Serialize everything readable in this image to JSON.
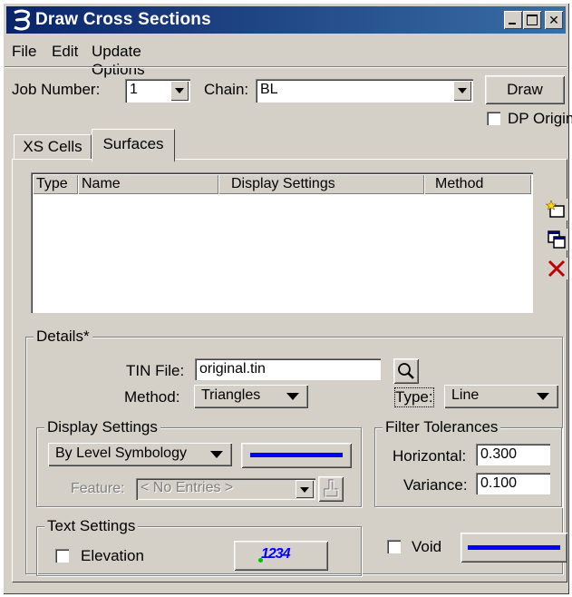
{
  "window": {
    "title": "Draw Cross Sections",
    "title_bar_color": "#0a246a"
  },
  "title_buttons": {
    "minimize": "minimize-icon",
    "maximize": "maximize-icon",
    "close": "close-icon"
  },
  "menu": {
    "items": [
      "File",
      "Edit",
      "Update Options"
    ]
  },
  "header": {
    "job_number_label": "Job Number:",
    "job_number_value": "1",
    "chain_label": "Chain:",
    "chain_value": "BL",
    "draw_button": "Draw",
    "dp_origin_label": "DP Origin",
    "dp_origin_checked": false
  },
  "tabs": [
    {
      "label": "XS Cells",
      "active": false
    },
    {
      "label": "Surfaces",
      "active": true
    }
  ],
  "surfaces_list": {
    "columns": [
      "Type",
      "Name",
      "Display Settings",
      "Method"
    ],
    "rows": []
  },
  "side_tools": [
    "add-surface-icon",
    "duplicate-surface-icon",
    "delete-surface-icon"
  ],
  "details": {
    "title": "Details*",
    "tin_file_label": "TIN File:",
    "tin_file_value": "original.tin",
    "method_label": "Method:",
    "method_value": "Triangles",
    "type_label": "Type:",
    "type_value": "Line"
  },
  "display_settings": {
    "title": "Display Settings",
    "symbology_value": "By Level Symbology",
    "line_color": "#0000ff",
    "feature_label": "Feature:",
    "feature_value": "< No Entries >"
  },
  "filter_tolerances": {
    "title": "Filter Tolerances",
    "horizontal_label": "Horizontal:",
    "horizontal_value": "0.300",
    "variance_label": "Variance:",
    "variance_value": "0.100"
  },
  "text_settings": {
    "title": "Text Settings",
    "elevation_label": "Elevation",
    "elevation_checked": false,
    "sample_text": "1234",
    "sample_color": "#0000ff"
  },
  "void": {
    "label": "Void",
    "checked": false,
    "line_color": "#0000ff"
  }
}
